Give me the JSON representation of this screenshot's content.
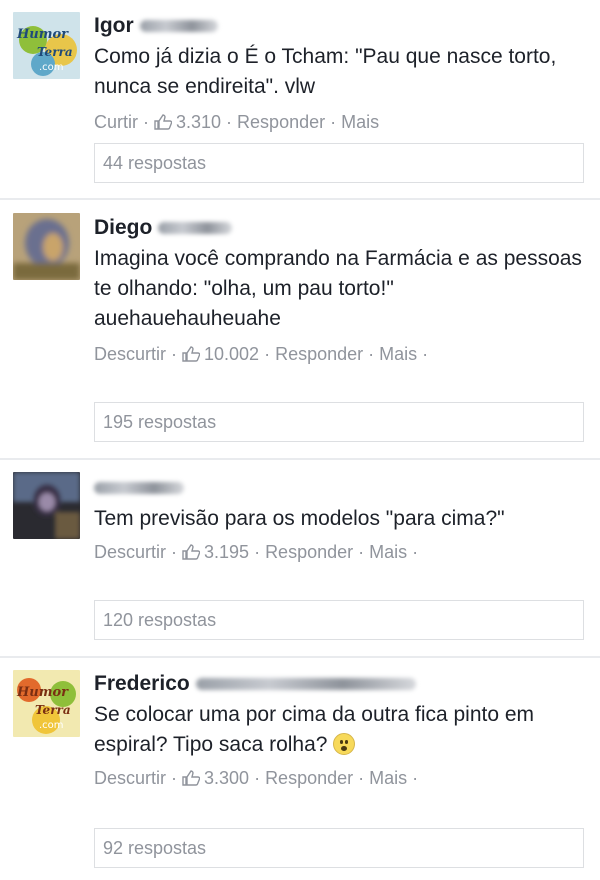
{
  "comments": [
    {
      "name": "Igor",
      "text": "Como já dizia o É o Tcham: \"Pau que nasce torto, nunca se endireita\". vlw",
      "like_label": "Curtir",
      "like_count": "3.310",
      "reply_label": "Responder",
      "more_label": "Mais",
      "replies": "44 respostas",
      "avatar_text": "Humor da Terra .com"
    },
    {
      "name": "Diego",
      "text": "Imagina você comprando na Farmácia e as pessoas te olhando: \"olha, um pau torto!\" auehauehauheuahe",
      "like_label": "Descurtir",
      "like_count": "10.002",
      "reply_label": "Responder",
      "more_label": "Mais",
      "replies": "195 respostas"
    },
    {
      "name": "",
      "text": "Tem previsão para os modelos \"para cima?\"",
      "like_label": "Descurtir",
      "like_count": "3.195",
      "reply_label": "Responder",
      "more_label": "Mais",
      "replies": "120 respostas"
    },
    {
      "name": "Frederico",
      "text": "Se colocar uma por cima da outra fica pinto em espiral? Tipo saca rolha?",
      "like_label": "Descurtir",
      "like_count": "3.300",
      "reply_label": "Responder",
      "more_label": "Mais",
      "replies": "92 respostas",
      "avatar_text": "Humor da Terra .com"
    }
  ],
  "colors": {
    "meta": "#90949c",
    "text": "#1d2129",
    "border": "#dddfe2"
  },
  "icons": {
    "like": "thumbs-up-icon",
    "emoji": "surprised-face-icon"
  }
}
